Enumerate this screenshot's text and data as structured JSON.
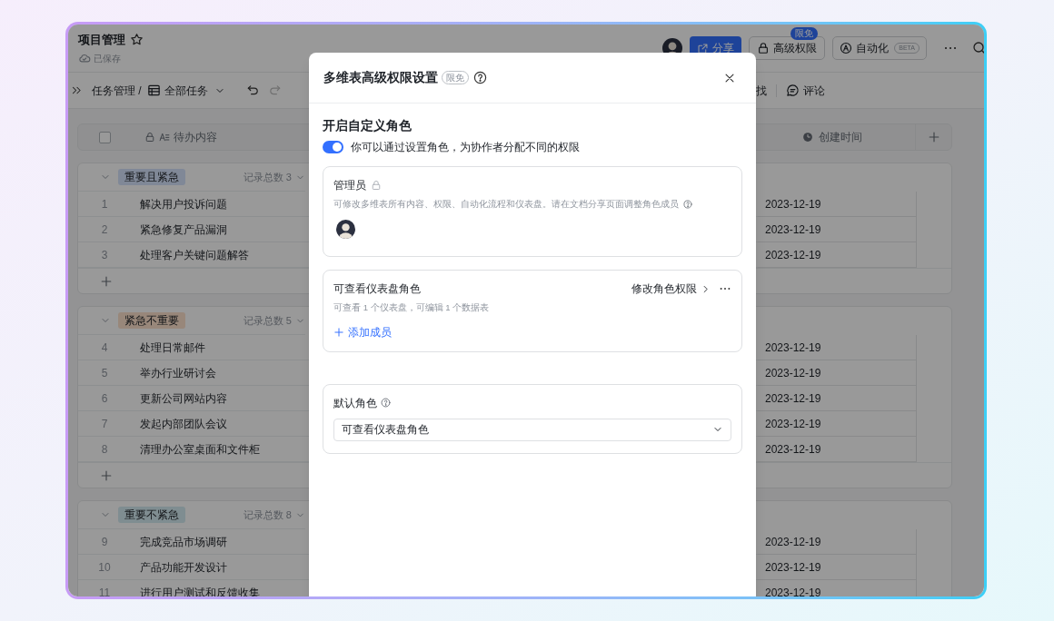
{
  "app": {
    "title": "项目管理",
    "save_status": "已保存"
  },
  "header_actions": {
    "share": "分享",
    "advanced_permissions": {
      "label": "高级权限",
      "badge": "限免"
    },
    "automation": {
      "label": "自动化",
      "badge": "BETA"
    }
  },
  "toolbar": {
    "breadcrumb": "任务管理 /",
    "view": "全部任务",
    "find_partial": "找",
    "comment": "评论"
  },
  "table": {
    "select_all": {
      "checked": false
    },
    "columns": [
      {
        "label": "待办内容"
      },
      {
        "label": "创建时间"
      }
    ],
    "groups": [
      {
        "tag": "重要且紧急",
        "color": "#808897",
        "count_label": "记录总数 3",
        "rows": [
          {
            "index": "1",
            "title": "解决用户投诉问题",
            "created": "2023-12-19"
          },
          {
            "index": "2",
            "title": "紧急修复产品漏洞",
            "created": "2023-12-19"
          },
          {
            "index": "3",
            "title": "处理客户关键问题解答",
            "created": "2023-12-19"
          }
        ]
      },
      {
        "tag": "紧急不重要",
        "color": "#98877a",
        "count_label": "记录总数 5",
        "rows": [
          {
            "index": "4",
            "title": "处理日常邮件",
            "created": "2023-12-19"
          },
          {
            "index": "5",
            "title": "举办行业研讨会",
            "created": "2023-12-19"
          },
          {
            "index": "6",
            "title": "更新公司网站内容",
            "created": "2023-12-19"
          },
          {
            "index": "7",
            "title": "发起内部团队会议",
            "created": "2023-12-19"
          },
          {
            "index": "8",
            "title": "清理办公室桌面和文件柜",
            "created": "2023-12-19"
          }
        ]
      },
      {
        "tag": "重要不紧急",
        "color": "#7f8d91",
        "count_label": "记录总数 8",
        "rows": [
          {
            "index": "9",
            "title": "完成竞品市场调研",
            "created": "2023-12-19"
          },
          {
            "index": "10",
            "title": "产品功能开发设计",
            "created": "2023-12-19"
          },
          {
            "index": "11",
            "title": "进行用户测试和反馈收集",
            "created": "2023-12-19"
          }
        ]
      }
    ]
  },
  "dialog": {
    "title": "多维表高级权限设置",
    "badge": "限免",
    "section_title": "开启自定义角色",
    "toggle": {
      "on": true,
      "label": "你可以通过设置角色，为协作者分配不同的权限"
    },
    "roles": [
      {
        "kind": "locked",
        "name": "管理员",
        "description": "可修改多维表所有内容、权限、自动化流程和仪表盘。请在文档分享页面调整角色成员"
      },
      {
        "kind": "custom",
        "name": "可查看仪表盘角色",
        "edit_link": "修改角色权限",
        "description": "可查看 1 个仪表盘，可编辑 1 个数据表",
        "add_member": "添加成员"
      }
    ],
    "default_role": {
      "label": "默认角色",
      "value": "可查看仪表盘角色"
    }
  }
}
